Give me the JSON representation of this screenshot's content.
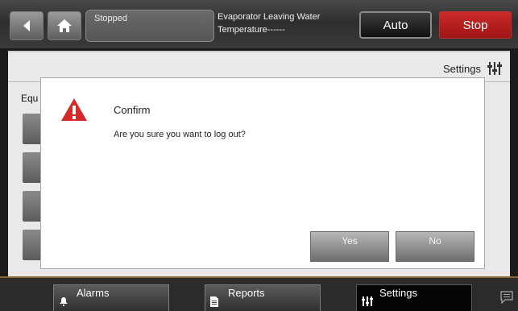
{
  "topbar": {
    "status_text": "Stopped",
    "evap_line1": "Evaporator Leaving Water",
    "evap_label": "Temperature",
    "evap_value": "------",
    "auto_label": "Auto",
    "stop_label": "Stop"
  },
  "main": {
    "settings_label": "Settings",
    "section_label_partial": "Equ"
  },
  "dialog": {
    "title": "Confirm",
    "message": "Are you sure you want to log out?",
    "yes_label": "Yes",
    "no_label": "No"
  },
  "bottom_nav": {
    "alarms_label": "Alarms",
    "reports_label": "Reports",
    "settings_label": "Settings"
  },
  "colors": {
    "stop_red": "#c11f1f",
    "warning_red": "#d42a2a",
    "accent_gold": "#8a6a2a"
  },
  "icons": [
    "back-arrow-icon",
    "home-icon",
    "settings-sliders-icon",
    "warning-icon",
    "alarm-bell-icon",
    "report-document-icon",
    "chat-icon"
  ]
}
